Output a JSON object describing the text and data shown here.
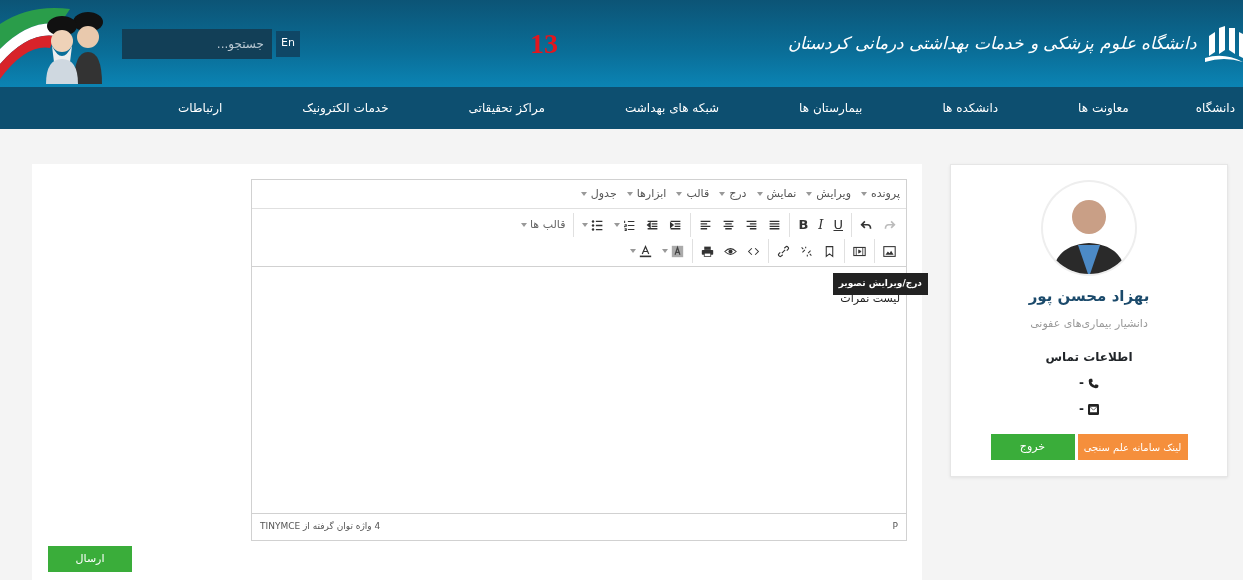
{
  "header": {
    "logo_text": "دانشگاه علوم پزشکی و خدمات بهداشتی درمانی کردستان",
    "badge": "13",
    "language_button": "En",
    "search": {
      "placeholder": "جستجو..."
    }
  },
  "nav": [
    {
      "label": "دانشگاه"
    },
    {
      "label": "معاونت ها"
    },
    {
      "label": "دانشکده ها"
    },
    {
      "label": "بیمارستان ها"
    },
    {
      "label": "شبکه های بهداشت"
    },
    {
      "label": "مراکز تحقیقاتی"
    },
    {
      "label": "خدمات الکترونیک"
    },
    {
      "label": "ارتباطات"
    }
  ],
  "profile": {
    "name": "بهزاد محسن پور",
    "title": "دانشیار بیماری‌های عفونی",
    "contact_heading": "اطلاعات تماس",
    "contacts": [
      {
        "kind": "phone",
        "value": "-"
      },
      {
        "kind": "email",
        "value": "-"
      }
    ],
    "buttons": [
      {
        "label": "لینک سامانه علم سنجی",
        "kind": "warning"
      },
      {
        "label": "خروج",
        "kind": "success"
      }
    ]
  },
  "editor": {
    "menu": [
      {
        "label": "پرونده"
      },
      {
        "label": "ویرایش"
      },
      {
        "label": "نمایش"
      },
      {
        "label": "درج"
      },
      {
        "label": "قالب"
      },
      {
        "label": "ابزارها"
      },
      {
        "label": "جدول"
      }
    ],
    "toolbar": [
      [
        [
          {
            "kind": "icon",
            "dropdown": false,
            "disabled": true
          },
          {
            "kind": "icon",
            "dropdown": false,
            "disabled": false
          }
        ],
        [
          {
            "kind": "text",
            "text": "U",
            "dropdown": false,
            "disabled": false
          },
          {
            "kind": "text",
            "text": "I",
            "dropdown": false,
            "disabled": false
          },
          {
            "kind": "text",
            "text": "B",
            "dropdown": false,
            "disabled": false
          }
        ],
        [
          {
            "kind": "icon",
            "dropdown": false,
            "disabled": false
          },
          {
            "kind": "icon",
            "dropdown": false,
            "disabled": false
          },
          {
            "kind": "icon",
            "dropdown": false,
            "disabled": false
          },
          {
            "kind": "icon",
            "dropdown": false,
            "disabled": false
          }
        ],
        [
          {
            "kind": "icon",
            "dropdown": false,
            "disabled": false
          },
          {
            "kind": "icon",
            "dropdown": false,
            "disabled": false
          },
          {
            "kind": "icon",
            "dropdown": true,
            "disabled": false
          },
          {
            "kind": "icon",
            "dropdown": true,
            "disabled": false
          }
        ],
        [
          {
            "kind": "text",
            "text": "قالب ها",
            "dropdown": true,
            "disabled": false
          }
        ]
      ],
      [
        [
          {
            "kind": "icon",
            "dropdown": false,
            "disabled": false
          }
        ],
        [
          {
            "kind": "icon",
            "dropdown": false,
            "disabled": false
          }
        ],
        [
          {
            "kind": "icon",
            "dropdown": false,
            "disabled": false
          },
          {
            "kind": "icon",
            "dropdown": false,
            "disabled": false
          },
          {
            "kind": "icon",
            "dropdown": false,
            "disabled": false
          }
        ],
        [
          {
            "kind": "icon",
            "dropdown": false,
            "disabled": false
          },
          {
            "kind": "icon",
            "dropdown": false,
            "disabled": false
          },
          {
            "kind": "icon",
            "dropdown": false,
            "disabled": false
          }
        ],
        [
          {
            "kind": "icon",
            "dropdown": true,
            "disabled": false
          },
          {
            "kind": "icon",
            "dropdown": true,
            "disabled": false
          }
        ]
      ]
    ],
    "tooltip": "درج/ویرایش تصویر",
    "content": [
      "لیست نمرات"
    ],
    "status_path": "P",
    "word_count": "4 واژه  توان گرفته از TINYMCE"
  },
  "submit_button": "ارسال"
}
